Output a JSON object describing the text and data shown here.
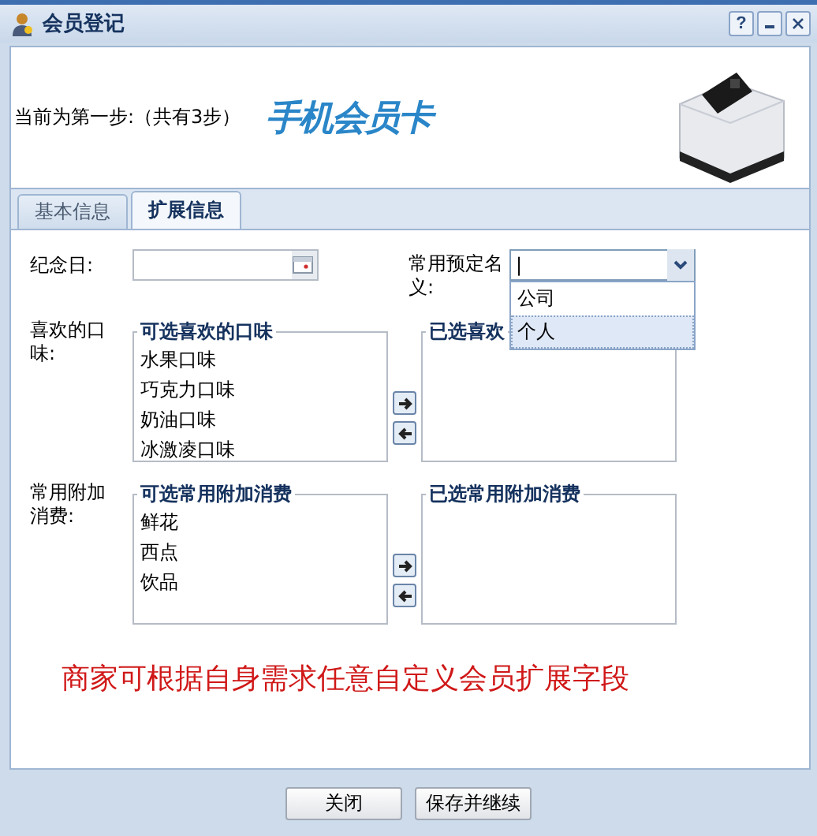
{
  "window": {
    "title": "会员登记",
    "controls": [
      {
        "kind": "help",
        "label": "?"
      },
      {
        "kind": "minimize"
      },
      {
        "kind": "close"
      }
    ]
  },
  "header": {
    "step_text": "当前为第一步:（共有3步）",
    "logo_text": "手机会员卡"
  },
  "tabs": [
    {
      "label": "基本信息",
      "selected": false
    },
    {
      "label": "扩展信息",
      "selected": true
    }
  ],
  "form": {
    "anniversary_label": "纪念日:",
    "preset_name_label": "常用预定名义:",
    "preset_name_value": "|",
    "preset_options": [
      {
        "label": "公司",
        "selected": false
      },
      {
        "label": "个人",
        "selected": true
      }
    ],
    "pickers": [
      {
        "label": "喜欢的口味:",
        "available_title": "可选喜欢的口味",
        "available_items": [
          "水果口味",
          "巧克力口味",
          "奶油口味",
          "冰激凌口味"
        ],
        "chosen_title": "已选喜欢"
      },
      {
        "label": "常用附加消费:",
        "available_title": "可选常用附加消费",
        "available_items": [
          "鲜花",
          "西点",
          "饮品"
        ],
        "chosen_title": "已选常用附加消费"
      }
    ],
    "notice": "商家可根据自身需求任意自定义会员扩展字段"
  },
  "buttons": [
    "关闭",
    "保存并继续"
  ]
}
